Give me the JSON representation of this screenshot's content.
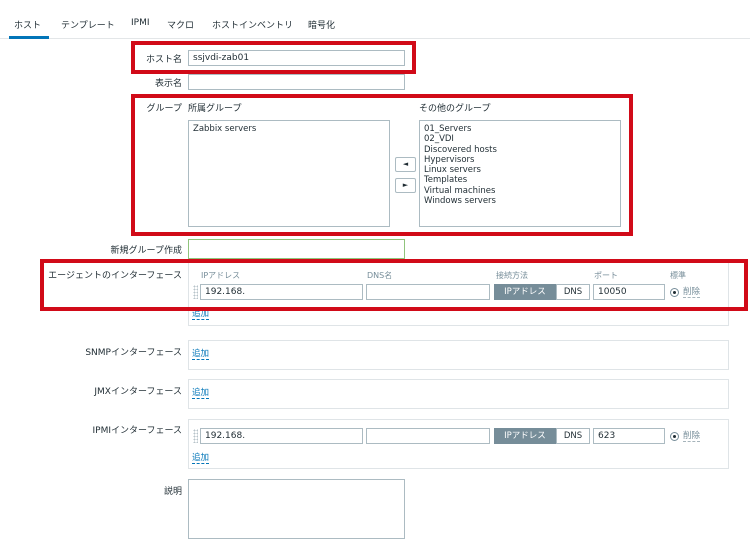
{
  "tabs": [
    "ホスト",
    "テンプレート",
    "IPMI",
    "マクロ",
    "ホストインベントリ",
    "暗号化"
  ],
  "form": {
    "hostname_label": "ホスト名",
    "hostname_value": "ssjvdi-zab01",
    "display_name_label": "表示名",
    "display_name_value": "",
    "groups_label": "グループ",
    "member_groups_label": "所属グループ",
    "member_groups": [
      "Zabbix servers"
    ],
    "other_groups_label": "その他のグループ",
    "other_groups": [
      "01_Servers",
      "02_VDI",
      "Discovered hosts",
      "Hypervisors",
      "Linux servers",
      "Templates",
      "Virtual machines",
      "Windows servers"
    ],
    "move_left": "◄",
    "move_right": "►",
    "new_group_label": "新規グループ作成",
    "new_group_value": "",
    "agent_label": "エージェントのインターフェース",
    "col_ip": "IPアドレス",
    "col_dns": "DNS名",
    "col_connect": "接続方法",
    "col_port": "ポート",
    "col_default": "標準",
    "agent_ip": "192.168.",
    "agent_dns": "",
    "conn_ip": "IPアドレス",
    "conn_dns": "DNS",
    "agent_port": "10050",
    "remove": "削除",
    "add": "追加",
    "snmp_label": "SNMPインターフェース",
    "jmx_label": "JMXインターフェース",
    "ipmi_label": "IPMIインターフェース",
    "ipmi_ip": "192.168.",
    "ipmi_dns": "",
    "ipmi_port": "623",
    "description_label": "説明",
    "description_value": ""
  },
  "colors": {
    "highlight": "#d10a18",
    "accent": "#0275b8",
    "active_segment": "#768d99"
  }
}
